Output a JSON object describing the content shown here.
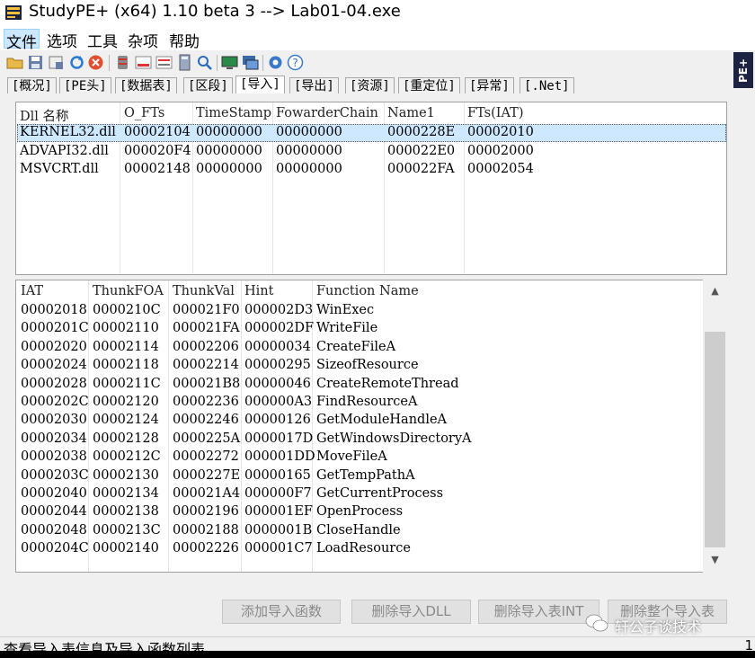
{
  "window": {
    "title": "StudyPE+ (x64) 1.10 beta 3  --> Lab01-04.exe"
  },
  "menu": [
    "文件",
    "选项",
    "工具",
    "杂项",
    "帮助"
  ],
  "side_badge": "PE+",
  "tabs": [
    "[概况]",
    "[PE头]",
    "[数据表]",
    "[区段]",
    "[导入]",
    "[导出]",
    "[资源]",
    "[重定位]",
    "[异常]",
    "[.Net]"
  ],
  "active_tab": "[导入]",
  "dll_table": {
    "headers": [
      "Dll 名称",
      "O_FTs",
      "TimeStamp",
      "FowarderChain",
      "Name1",
      "FTs(IAT)"
    ],
    "rows": [
      [
        "KERNEL32.dll",
        "00002104",
        "00000000",
        "00000000",
        "0000228E",
        "00002010"
      ],
      [
        "ADVAPI32.dll",
        "000020F4",
        "00000000",
        "00000000",
        "000022E0",
        "00002000"
      ],
      [
        "MSVCRT.dll",
        "00002148",
        "00000000",
        "00000000",
        "000022FA",
        "00002054"
      ]
    ]
  },
  "func_table": {
    "headers": [
      "IAT",
      "ThunkFOA",
      "ThunkVal",
      "Hint",
      "Function Name"
    ],
    "rows": [
      [
        "00002018",
        "0000210C",
        "000021F0",
        "000002D3",
        "WinExec"
      ],
      [
        "0000201C",
        "00002110",
        "000021FA",
        "000002DF",
        "WriteFile"
      ],
      [
        "00002020",
        "00002114",
        "00002206",
        "00000034",
        "CreateFileA"
      ],
      [
        "00002024",
        "00002118",
        "00002214",
        "00000295",
        "SizeofResource"
      ],
      [
        "00002028",
        "0000211C",
        "000021B8",
        "00000046",
        "CreateRemoteThread"
      ],
      [
        "0000202C",
        "00002120",
        "00002236",
        "000000A3",
        "FindResourceA"
      ],
      [
        "00002030",
        "00002124",
        "00002246",
        "00000126",
        "GetModuleHandleA"
      ],
      [
        "00002034",
        "00002128",
        "0000225A",
        "0000017D",
        "GetWindowsDirectoryA"
      ],
      [
        "00002038",
        "0000212C",
        "00002272",
        "000001DD",
        "MoveFileA"
      ],
      [
        "0000203C",
        "00002130",
        "0000227E",
        "00000165",
        "GetTempPathA"
      ],
      [
        "00002040",
        "00002134",
        "000021A4",
        "000000F7",
        "GetCurrentProcess"
      ],
      [
        "00002044",
        "00002138",
        "00002196",
        "000001EF",
        "OpenProcess"
      ],
      [
        "00002048",
        "0000213C",
        "00002188",
        "0000001B",
        "CloseHandle"
      ],
      [
        "0000204C",
        "00002140",
        "00002226",
        "000001C7",
        "LoadResource"
      ]
    ]
  },
  "buttons": {
    "add_func": "添加导入函数",
    "del_dll": "删除导入DLL",
    "del_table_item": "删除导入表INT",
    "del_all": "删除整个导入表"
  },
  "status": {
    "text": "查看导入表信息及导入函数列表",
    "right": "1"
  },
  "watermark": "轩公子谈技术",
  "colors": {
    "selection": "#cde8ff",
    "badge": "#1c2340",
    "disabled_text": "#8a8a8a"
  }
}
